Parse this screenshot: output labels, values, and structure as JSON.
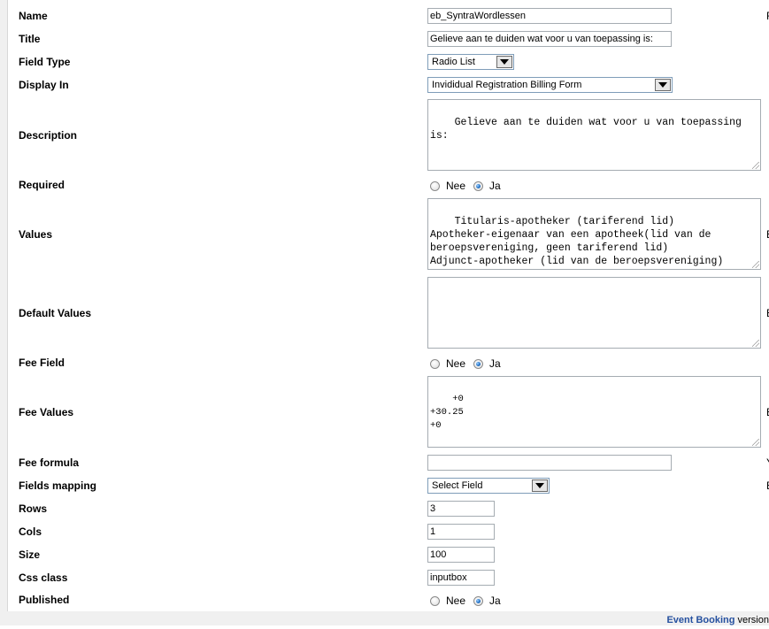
{
  "fields": {
    "name": {
      "label": "Name",
      "value": "eb_SyntraWordlessen"
    },
    "title": {
      "label": "Title",
      "value": "Gelieve aan te duiden wat voor u van toepassing is:"
    },
    "field_type": {
      "label": "Field Type",
      "value": "Radio List"
    },
    "display_in": {
      "label": "Display In",
      "value": "Invididual Registration Billing Form"
    },
    "description": {
      "label": "Description",
      "value": "Gelieve aan te duiden wat voor u van toepassing is:"
    },
    "required": {
      "label": "Required",
      "opt_no": "Nee",
      "opt_yes": "Ja",
      "selected": "Ja"
    },
    "values": {
      "label": "Values",
      "value": "Titularis-apotheker (tariferend lid)\nApotheker-eigenaar van een apotheek(lid van de beroepsvereniging, geen tariferend lid)\nAdjunct-apotheker (lid van de beroepsvereniging)"
    },
    "default_values": {
      "label": "Default Values",
      "value": ""
    },
    "fee_field": {
      "label": "Fee Field",
      "opt_no": "Nee",
      "opt_yes": "Ja",
      "selected": "Ja"
    },
    "fee_values": {
      "label": "Fee Values",
      "value": "+0\n+30.25\n+0"
    },
    "fee_formula": {
      "label": "Fee formula",
      "value": ""
    },
    "fields_mapping": {
      "label": "Fields mapping",
      "value": "Select Field"
    },
    "rows": {
      "label": "Rows",
      "value": "3"
    },
    "cols": {
      "label": "Cols",
      "value": "1"
    },
    "size": {
      "label": "Size",
      "value": "100"
    },
    "css_class": {
      "label": "Css class",
      "value": "inputbox"
    },
    "published": {
      "label": "Published",
      "opt_no": "Nee",
      "opt_yes": "Ja",
      "selected": "Ja"
    }
  },
  "right_edge_clips": {
    "name": "F",
    "values": "E",
    "default_values": "E",
    "fee_values": "E",
    "fee_formula": "Y",
    "fields_mapping": "E"
  },
  "footer": {
    "brand": "Event Booking",
    "text": " version"
  }
}
